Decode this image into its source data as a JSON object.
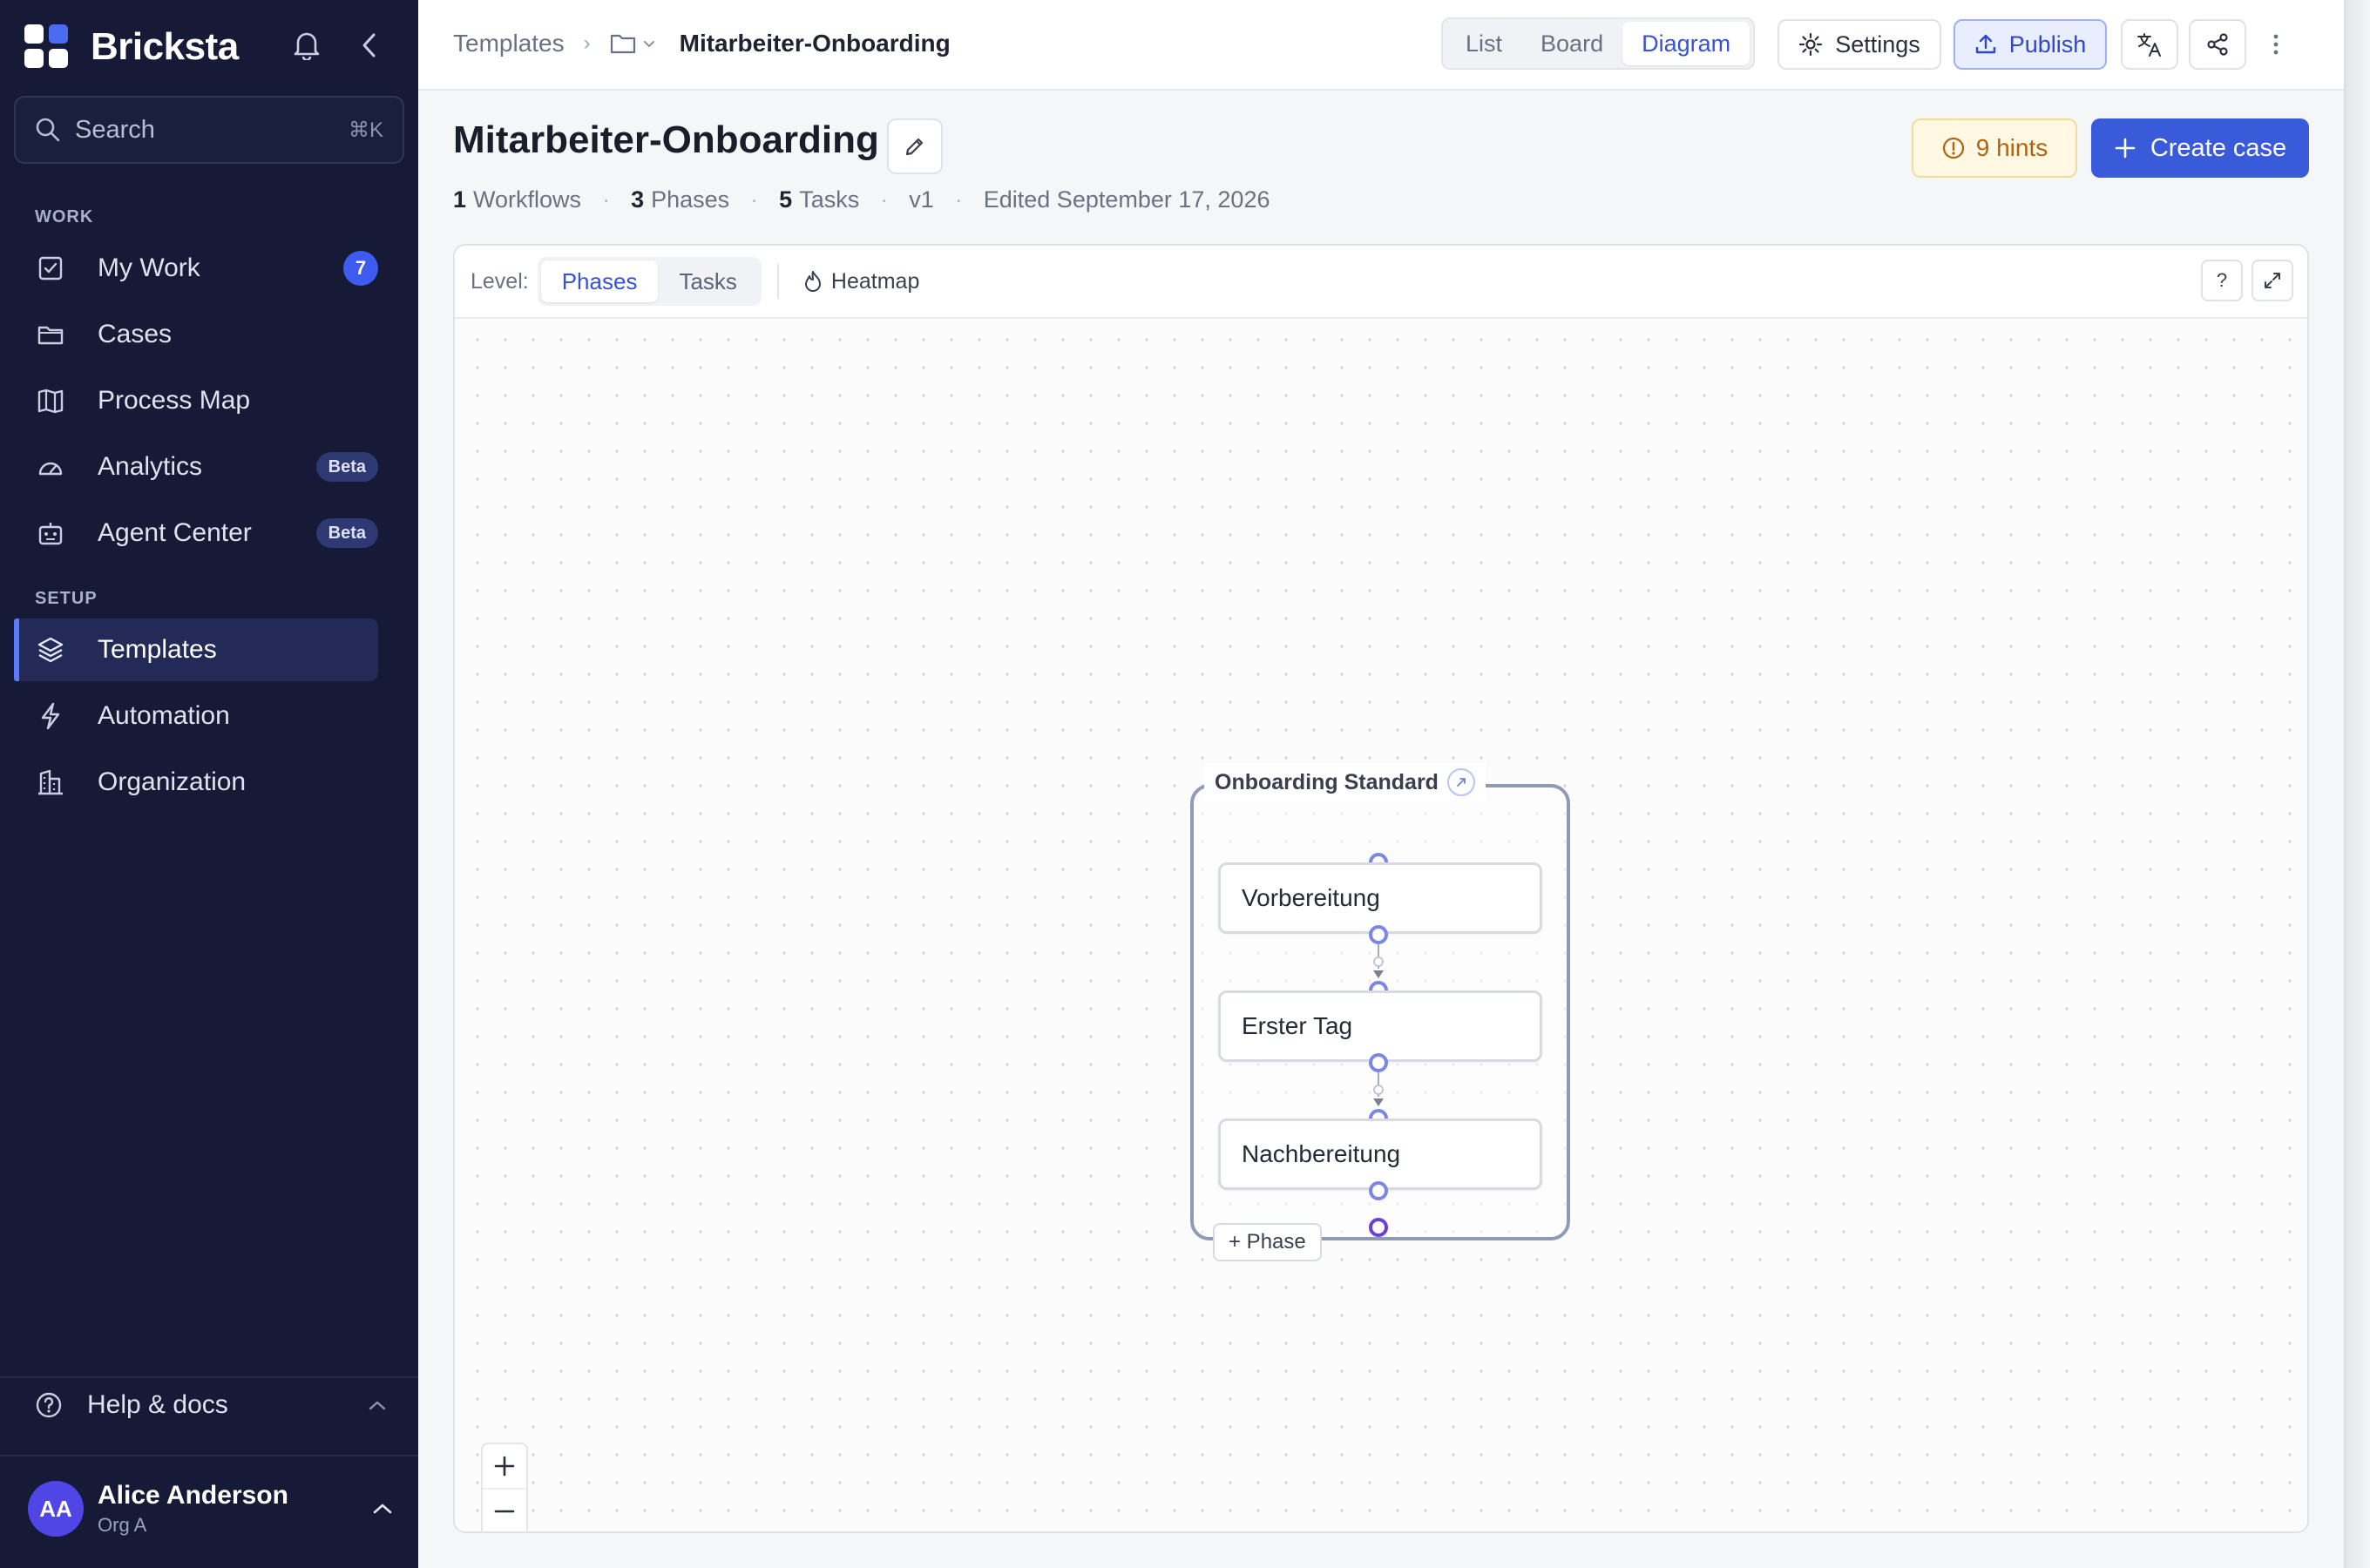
{
  "app": {
    "name": "Bricksta"
  },
  "sidebar": {
    "search": {
      "placeholder": "Search",
      "shortcut": "⌘K"
    },
    "sections": {
      "work": "WORK",
      "setup": "SETUP"
    },
    "work_items": [
      {
        "label": "My Work",
        "icon": "checkbox-icon",
        "badge": "7"
      },
      {
        "label": "Cases",
        "icon": "folder-icon"
      },
      {
        "label": "Process Map",
        "icon": "map-icon"
      },
      {
        "label": "Analytics",
        "icon": "gauge-icon",
        "badge": "Beta"
      },
      {
        "label": "Agent Center",
        "icon": "robot-icon",
        "badge": "Beta"
      }
    ],
    "setup_items": [
      {
        "label": "Templates",
        "icon": "layers-icon",
        "active": true
      },
      {
        "label": "Automation",
        "icon": "bolt-icon"
      },
      {
        "label": "Organization",
        "icon": "building-icon"
      }
    ],
    "help": "Help & docs",
    "user": {
      "initials": "AA",
      "name": "Alice Anderson",
      "org": "Org A"
    }
  },
  "topbar": {
    "breadcrumb": {
      "root": "Templates",
      "current": "Mitarbeiter-Onboarding"
    },
    "views": [
      {
        "label": "List",
        "selected": false
      },
      {
        "label": "Board",
        "selected": false
      },
      {
        "label": "Diagram",
        "selected": true
      }
    ],
    "settings_label": "Settings",
    "publish_label": "Publish"
  },
  "header": {
    "title": "Mitarbeiter-Onboarding",
    "meta": {
      "workflows_count": "1",
      "workflows_label": "Workflows",
      "phases_count": "3",
      "phases_label": "Phases",
      "tasks_count": "5",
      "tasks_label": "Tasks",
      "version": "v1",
      "edited": "Edited September 17, 2026"
    },
    "hints_label": "9 hints",
    "create_label": "Create case"
  },
  "canvas": {
    "level_label": "Level:",
    "levels": [
      {
        "label": "Phases",
        "selected": true
      },
      {
        "label": "Tasks",
        "selected": false
      }
    ],
    "heatmap_label": "Heatmap",
    "help_label": "?",
    "workflow": {
      "title": "Onboarding Standard",
      "phases": [
        "Vorbereitung",
        "Erster Tag",
        "Nachbereitung"
      ],
      "add_phase_label": "+ Phase"
    }
  },
  "colors": {
    "sidebar_bg": "#161a36",
    "accent": "#3a5bd9",
    "hint": "#b4620f"
  }
}
